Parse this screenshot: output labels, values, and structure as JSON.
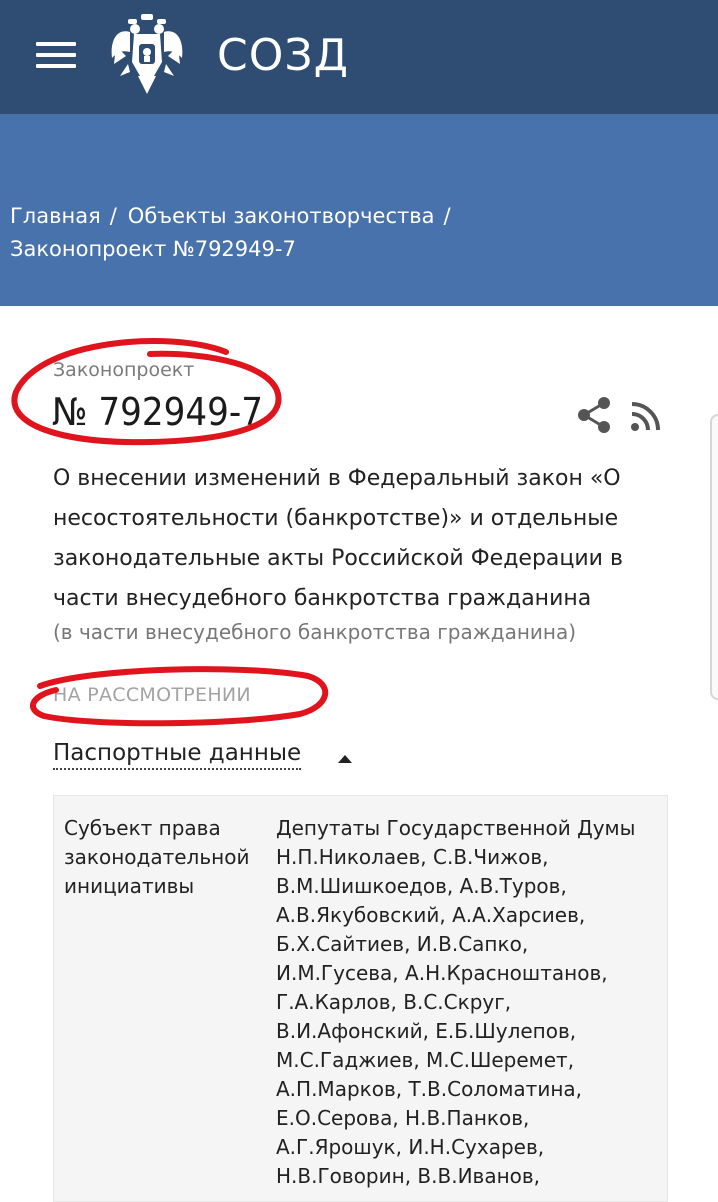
{
  "header": {
    "brand": "СОЗД"
  },
  "breadcrumb": {
    "items": [
      "Главная",
      "Объекты законотворчества",
      "Законопроект №792949-7"
    ]
  },
  "bill": {
    "kind": "Законопроект",
    "number": "№ 792949-7",
    "title_lines": [
      "О внесении изменений в Федеральный закон «О",
      "несостоятельности (банкротстве)» и отдельные",
      "законодательные акты Российской Федерации в",
      "части внесудебного банкротства гражданина"
    ],
    "subtitle": "(в части внесудебного банкротства гражданина)",
    "status": "НА РАССМОТРЕНИИ"
  },
  "passport": {
    "toggle_label": "Паспортные данные",
    "row": {
      "label_lines": [
        "Субъект права",
        "законодательной",
        "инициативы"
      ],
      "value_lines": [
        "Депутаты Государственной Думы",
        "Н.П.Николаев, С.В.Чижов,",
        "В.М.Шишкоедов, А.В.Туров,",
        "А.В.Якубовский, А.А.Харсиев,",
        "Б.Х.Сайтиев, И.В.Сапко,",
        "И.М.Гусева, А.Н.Красноштанов,",
        "Г.А.Карлов, В.С.Скруг,",
        "В.И.Афонский, Е.Б.Шулепов,",
        "М.С.Гаджиев, М.С.Шеремет,",
        "А.П.Марков, Т.В.Соломатина,",
        "Е.О.Серова, Н.В.Панков,",
        "А.Г.Ярошук, И.Н.Сухарев,",
        "Н.В.Говорин, В.В.Иванов,"
      ]
    }
  },
  "colors": {
    "topbar": "#2f4c72",
    "banner": "#4872ab",
    "annotation": "#e0141d"
  },
  "icons": [
    "menu-icon",
    "coat-of-arms-icon",
    "share-icon",
    "rss-icon",
    "caret-up-icon"
  ]
}
